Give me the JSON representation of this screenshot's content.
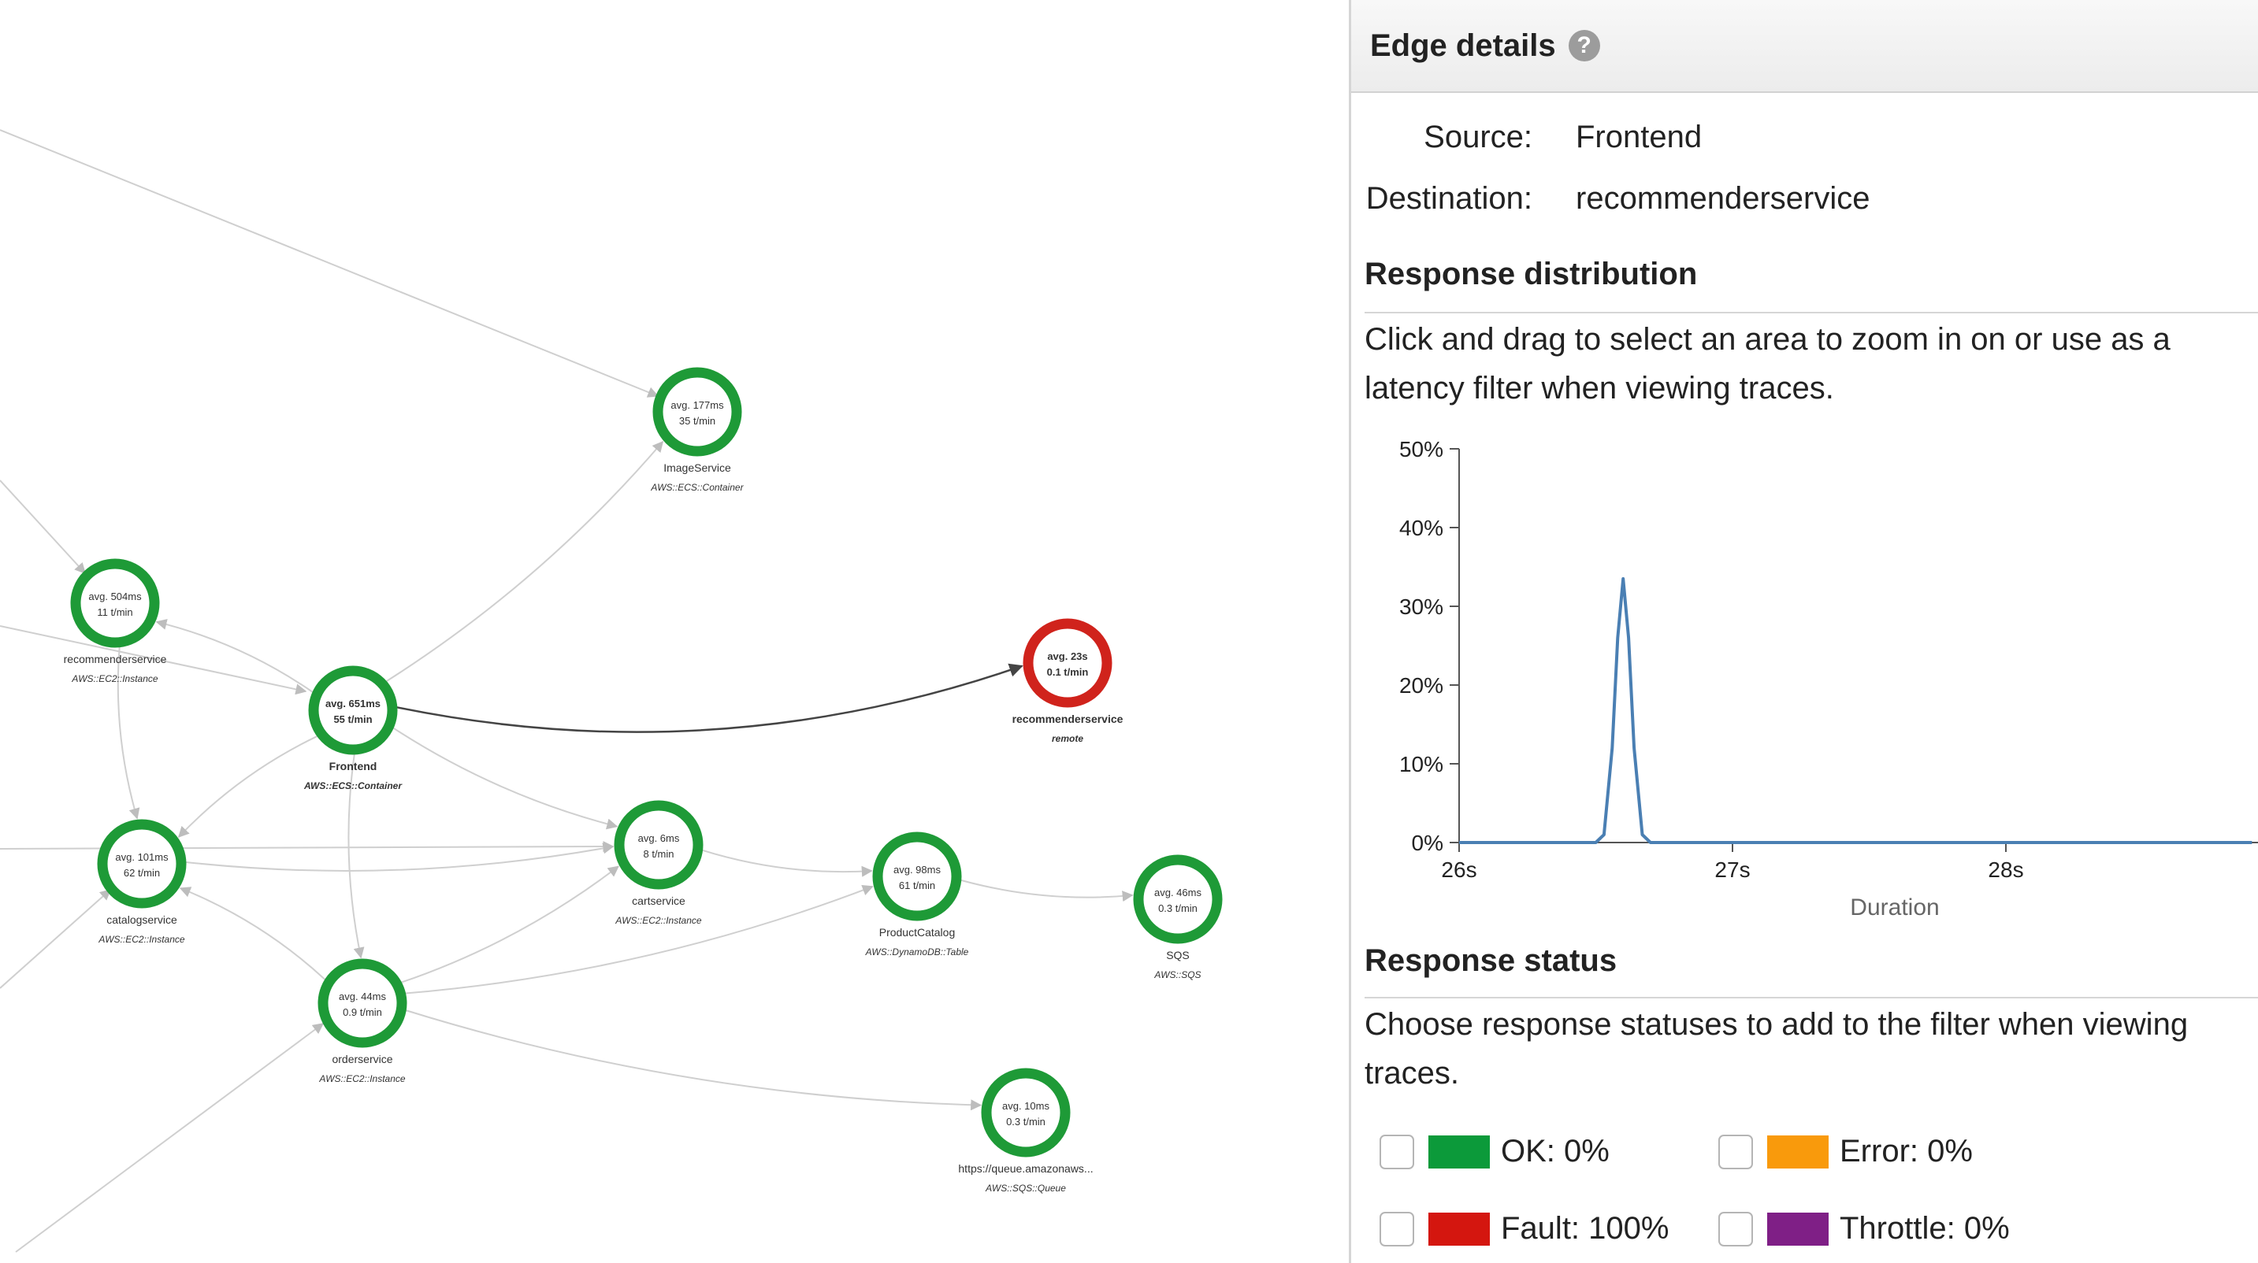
{
  "map": {
    "nodes": [
      {
        "id": "imageservice",
        "avg": "avg. 177ms",
        "rate": "35 t/min",
        "name": "ImageService",
        "type": "AWS::ECS::Container",
        "status": "ok",
        "bold": false
      },
      {
        "id": "recommenderservice",
        "avg": "avg. 504ms",
        "rate": "11 t/min",
        "name": "recommenderservice",
        "type": "AWS::EC2::Instance",
        "status": "ok",
        "bold": false
      },
      {
        "id": "frontend",
        "avg": "avg. 651ms",
        "rate": "55 t/min",
        "name": "Frontend",
        "type": "AWS::ECS::Container",
        "status": "ok",
        "bold": true
      },
      {
        "id": "recommenderservice-remote",
        "avg": "avg. 23s",
        "rate": "0.1 t/min",
        "name": "recommenderservice",
        "type": "remote",
        "status": "fault",
        "bold": true
      },
      {
        "id": "catalogservice",
        "avg": "avg. 101ms",
        "rate": "62 t/min",
        "name": "catalogservice",
        "type": "AWS::EC2::Instance",
        "status": "ok",
        "bold": false
      },
      {
        "id": "cartservice",
        "avg": "avg. 6ms",
        "rate": "8 t/min",
        "name": "cartservice",
        "type": "AWS::EC2::Instance",
        "status": "ok",
        "bold": false
      },
      {
        "id": "productcatalog",
        "avg": "avg. 98ms",
        "rate": "61 t/min",
        "name": "ProductCatalog",
        "type": "AWS::DynamoDB::Table",
        "status": "ok",
        "bold": false
      },
      {
        "id": "sqs",
        "avg": "avg. 46ms",
        "rate": "0.3 t/min",
        "name": "SQS",
        "type": "AWS::SQS",
        "status": "ok",
        "bold": false
      },
      {
        "id": "orderservice",
        "avg": "avg. 44ms",
        "rate": "0.9 t/min",
        "name": "orderservice",
        "type": "AWS::EC2::Instance",
        "status": "ok",
        "bold": false
      },
      {
        "id": "queue",
        "avg": "avg. 10ms",
        "rate": "0.3 t/min",
        "name": "https://queue.amazonaws...",
        "type": "AWS::SQS::Queue",
        "status": "ok",
        "bold": false
      }
    ],
    "edges": [
      {
        "from": "frontend",
        "to": "recommenderservice-remote",
        "selected": true
      },
      {
        "from": "frontend",
        "to": "imageservice",
        "selected": false
      },
      {
        "from": "frontend",
        "to": "recommenderservice",
        "selected": false
      },
      {
        "from": "frontend",
        "to": "catalogservice",
        "selected": false
      },
      {
        "from": "frontend",
        "to": "cartservice",
        "selected": false
      },
      {
        "from": "frontend",
        "to": "orderservice",
        "selected": false
      },
      {
        "from": "recommenderservice",
        "to": "catalogservice",
        "selected": false
      },
      {
        "from": "catalogservice",
        "to": "cartservice",
        "selected": false
      },
      {
        "from": "cartservice",
        "to": "productcatalog",
        "selected": false
      },
      {
        "from": "productcatalog",
        "to": "sqs",
        "selected": false
      },
      {
        "from": "orderservice",
        "to": "catalogservice",
        "selected": false
      },
      {
        "from": "orderservice",
        "to": "cartservice",
        "selected": false
      },
      {
        "from": "orderservice",
        "to": "productcatalog",
        "selected": false
      },
      {
        "from": "orderservice",
        "to": "queue",
        "selected": false
      }
    ],
    "colors": {
      "ok": "#1e9a37",
      "fault": "#d0231c",
      "edge": "#cfcfcf",
      "edge_selected": "#444444"
    }
  },
  "panel": {
    "title": "Edge details",
    "help_icon": "help-circle-icon",
    "source_label": "Source:",
    "source_value": "Frontend",
    "destination_label": "Destination:",
    "destination_value": "recommenderservice",
    "distribution_title": "Response distribution",
    "distribution_help": "Click and drag to select an area to zoom in on or use as a latency filter when viewing traces.",
    "status_title": "Response status",
    "status_help": "Choose response statuses to add to the filter when viewing traces.",
    "statuses": [
      {
        "label": "OK: 0%",
        "color": "#0c9a3a",
        "checked": false
      },
      {
        "label": "Error: 0%",
        "color": "#f99a0c",
        "checked": false
      },
      {
        "label": "Fault: 100%",
        "color": "#d4160f",
        "checked": false
      },
      {
        "label": "Throttle: 0%",
        "color": "#7f1f86",
        "checked": false
      }
    ]
  },
  "chart_data": {
    "type": "line",
    "title": "",
    "xlabel": "Duration",
    "ylabel": "",
    "x_ticks": [
      "26s",
      "27s",
      "28s"
    ],
    "y_ticks": [
      "0%",
      "10%",
      "20%",
      "30%",
      "40%",
      "50%"
    ],
    "xlim": [
      26,
      28.9
    ],
    "ylim": [
      0,
      50
    ],
    "grid": false,
    "series_color": "#4a7fb3",
    "series": [
      {
        "x": [
          26.0,
          26.5,
          26.53,
          26.56,
          26.58,
          26.6,
          26.62,
          26.64,
          26.67,
          26.7,
          27.0,
          28.0,
          28.9
        ],
        "y": [
          0,
          0,
          1,
          12,
          26,
          33.5,
          26,
          12,
          1,
          0,
          0,
          0,
          0
        ]
      }
    ]
  }
}
